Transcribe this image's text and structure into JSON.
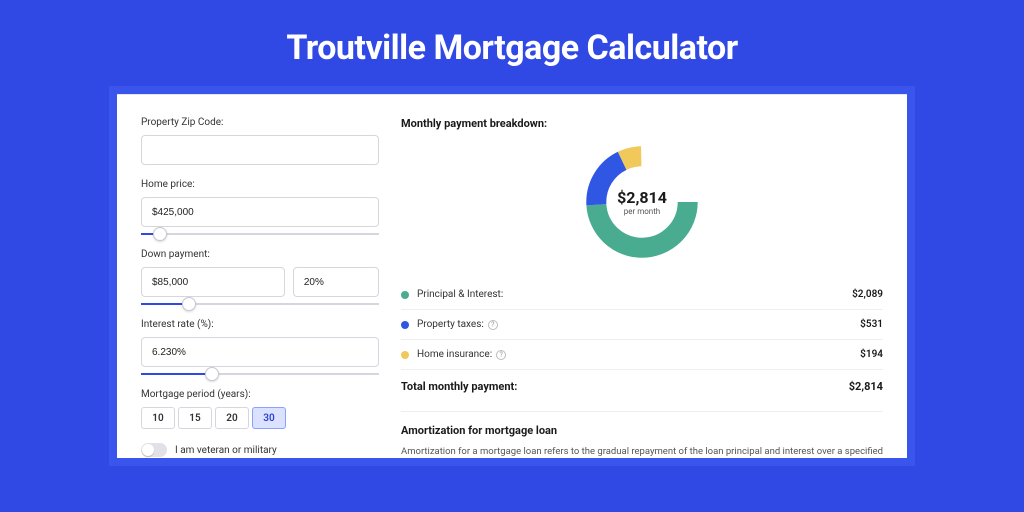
{
  "title": "Troutville Mortgage Calculator",
  "colors": {
    "primary": "#3049e4",
    "green": "#49ab8f",
    "blue": "#2f57e3",
    "yellow": "#f1c85a"
  },
  "form": {
    "zip_label": "Property Zip Code:",
    "zip_value": "",
    "home_price_label": "Home price:",
    "home_price_value": "$425,000",
    "home_price_slider_pct": 8,
    "down_label": "Down payment:",
    "down_value": "$85,000",
    "down_pct_value": "20%",
    "down_slider_pct": 20,
    "rate_label": "Interest rate (%):",
    "rate_value": "6.230%",
    "rate_slider_pct": 30,
    "period_label": "Mortgage period (years):",
    "periods": [
      "10",
      "15",
      "20",
      "30"
    ],
    "period_active": "30",
    "veteran_label": "I am veteran or military",
    "veteran_on": false
  },
  "breakdown": {
    "title": "Monthly payment breakdown:",
    "center_amount": "$2,814",
    "center_sub": "per month",
    "items": [
      {
        "label": "Principal & Interest:",
        "value": "$2,089",
        "color": "green",
        "help": false
      },
      {
        "label": "Property taxes:",
        "value": "$531",
        "color": "blue",
        "help": true
      },
      {
        "label": "Home insurance:",
        "value": "$194",
        "color": "yellow",
        "help": true
      }
    ],
    "total_label": "Total monthly payment:",
    "total_value": "$2,814"
  },
  "amort": {
    "title": "Amortization for mortgage loan",
    "text": "Amortization for a mortgage loan refers to the gradual repayment of the loan principal and interest over a specified"
  },
  "chart_data": {
    "type": "pie",
    "title": "Monthly payment breakdown",
    "series": [
      {
        "name": "Principal & Interest",
        "value": 2089,
        "color": "#49ab8f"
      },
      {
        "name": "Property taxes",
        "value": 531,
        "color": "#2f57e3"
      },
      {
        "name": "Home insurance",
        "value": 194,
        "color": "#f1c85a"
      }
    ],
    "total": 2814,
    "center_label": "$2,814 per month"
  }
}
